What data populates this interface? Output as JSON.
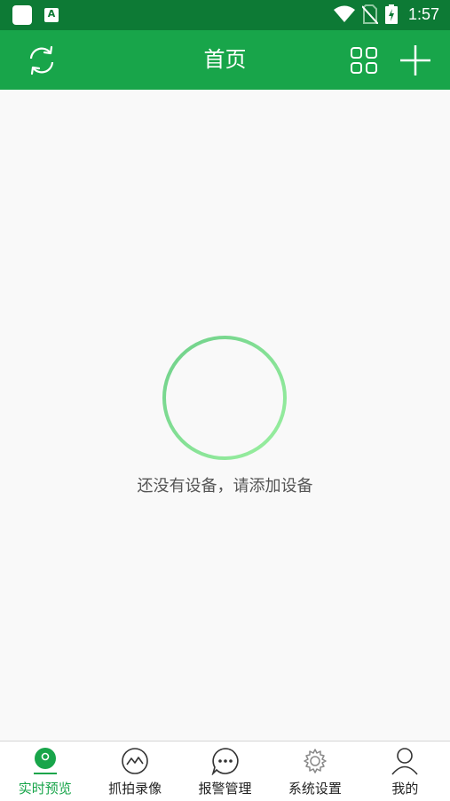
{
  "status_bar": {
    "time": "1:57",
    "notification_letter": "A"
  },
  "header": {
    "title": "首页"
  },
  "empty_state": {
    "message": "还没有设备，请添加设备"
  },
  "bottom_nav": [
    {
      "label": "实时预览",
      "icon": "live-preview-icon",
      "active": true
    },
    {
      "label": "抓拍录像",
      "icon": "snapshot-icon",
      "active": false
    },
    {
      "label": "报警管理",
      "icon": "alarm-chat-icon",
      "active": false
    },
    {
      "label": "系统设置",
      "icon": "settings-gear-icon",
      "active": false
    },
    {
      "label": "我的",
      "icon": "person-icon",
      "active": false
    }
  ],
  "colors": {
    "header": "#18a54a",
    "status_bar": "#0d7a35",
    "accent": "#18a54a",
    "empty_add_circle": "#7fdc8d"
  }
}
